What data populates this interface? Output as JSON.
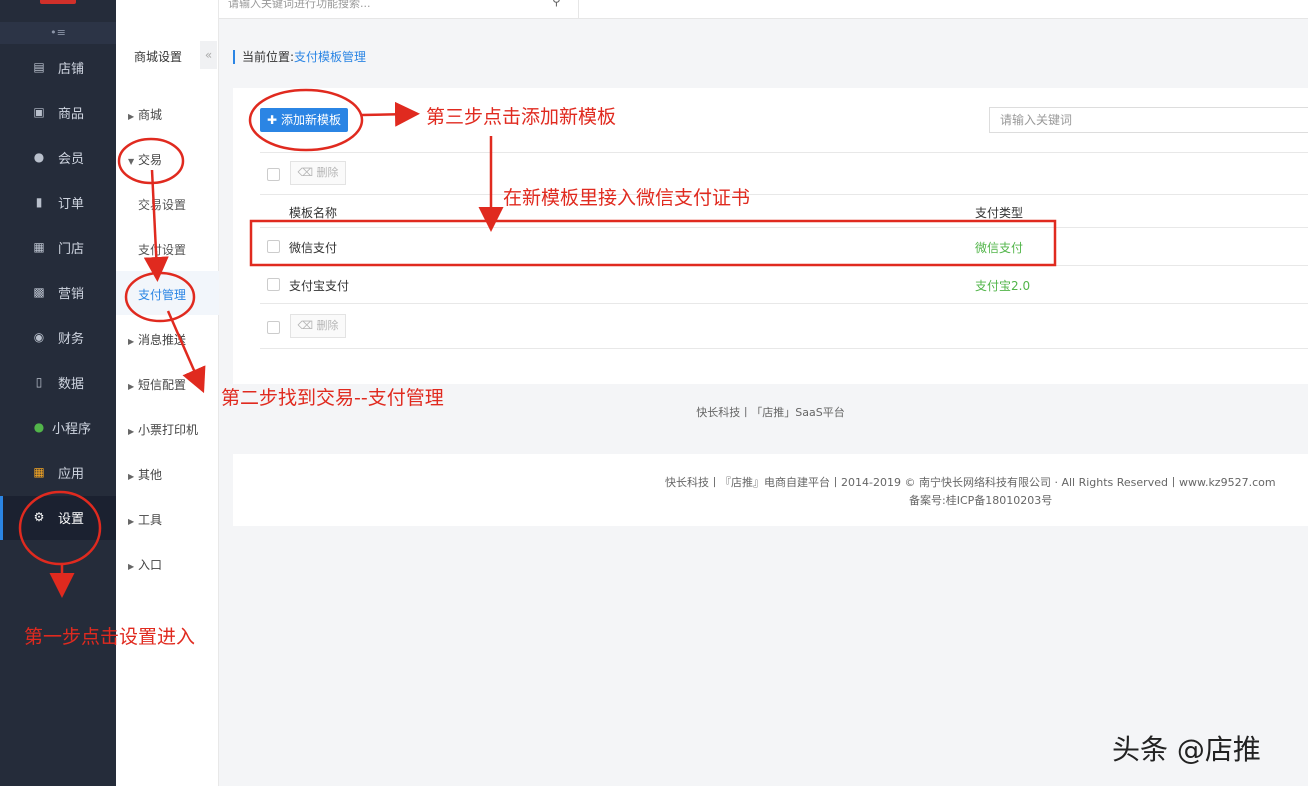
{
  "topbar": {
    "search_placeholder": "请输入关键词进行功能搜索...",
    "home_icon": "home-icon",
    "menu_icon": "menu-icon",
    "search_icon": "search-icon"
  },
  "sidebar": {
    "collapse_label": "•≡",
    "items": [
      {
        "label": "店铺",
        "icon": "store-icon"
      },
      {
        "label": "商品",
        "icon": "goods-icon"
      },
      {
        "label": "会员",
        "icon": "user-icon"
      },
      {
        "label": "订单",
        "icon": "order-icon"
      },
      {
        "label": "门店",
        "icon": "shop-icon"
      },
      {
        "label": "营销",
        "icon": "gift-icon"
      },
      {
        "label": "财务",
        "icon": "money-bag-icon"
      },
      {
        "label": "数据",
        "icon": "chart-icon"
      },
      {
        "label": "小程序",
        "icon": "mini-program-icon"
      },
      {
        "label": "应用",
        "icon": "apps-icon"
      },
      {
        "label": "设置",
        "icon": "gear-icon"
      }
    ]
  },
  "submenu": {
    "heading": "商城设置",
    "fold_label": "«",
    "items": [
      "商城",
      "交易",
      "交易设置",
      "支付设置",
      "支付管理",
      "消息推送",
      "短信配置",
      "小票打印机",
      "其他",
      "工具",
      "入口"
    ]
  },
  "breadcrumb": {
    "prefix": "当前位置:",
    "current": "支付模板管理"
  },
  "toolbar": {
    "add_label": "添加新模板",
    "keyword_placeholder": "请输入关键词",
    "delete_label": "删除"
  },
  "table": {
    "columns": [
      "模板名称",
      "支付类型"
    ],
    "rows": [
      {
        "name": "微信支付",
        "type": "微信支付"
      },
      {
        "name": "支付宝支付",
        "type": "支付宝2.0"
      }
    ]
  },
  "footer": {
    "brand": "快长科技丨「店推」SaaS平台",
    "copyright": "快长科技丨『店推』电商自建平台丨2014-2019 © 南宁快长网络科技有限公司 · All Rights Reserved丨www.kz9527.com",
    "icp": "备案号:桂ICP备18010203号"
  },
  "annotations": {
    "step1": "第一步点击设置进入",
    "step2": "第二步找到交易--支付管理",
    "step3": "第三步点击添加新模板",
    "step4": "在新模板里接入微信支付证书",
    "annotation_color": "#e02a1f"
  },
  "watermark": "头条 @店推",
  "colors": {
    "accent": "#2b85e4",
    "sidebar_bg": "#252c3a",
    "green": "#52b54a"
  }
}
